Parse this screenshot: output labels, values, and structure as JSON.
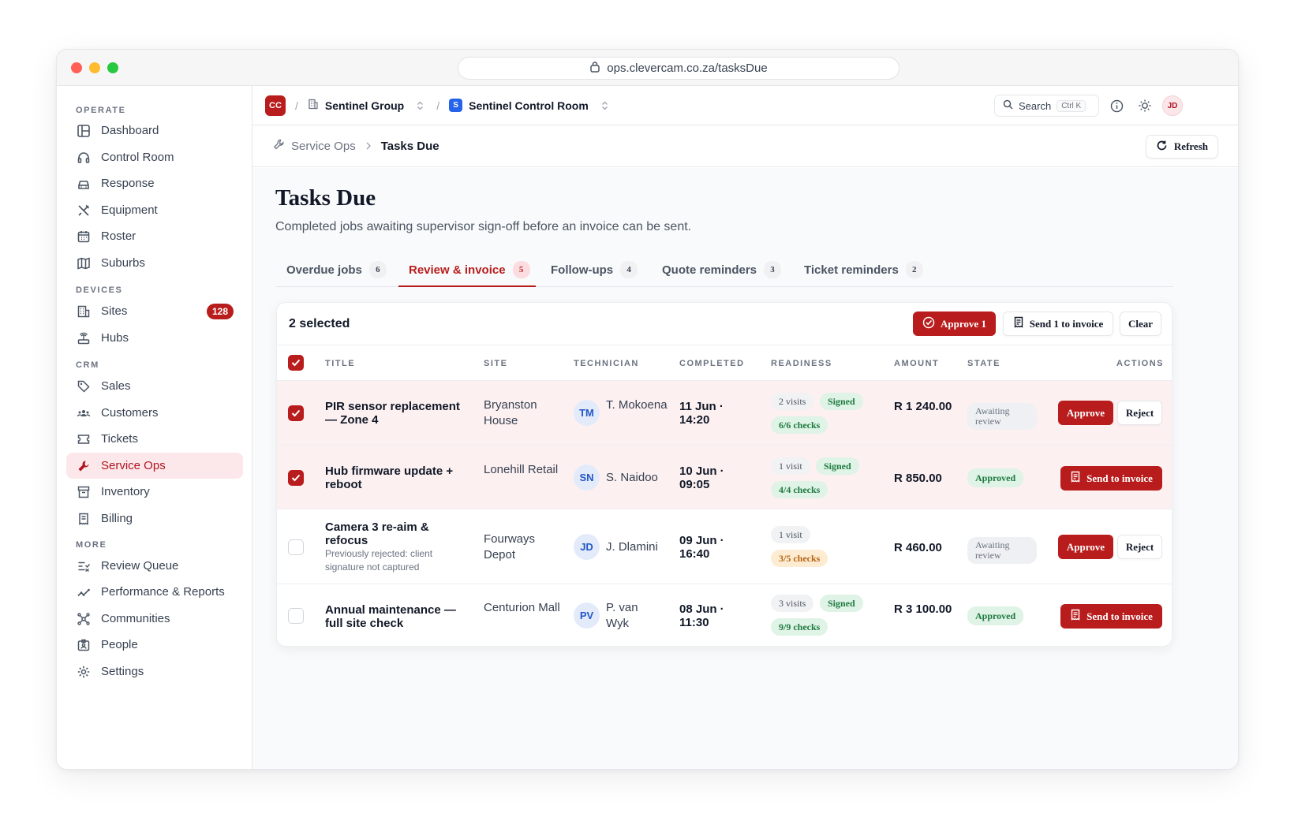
{
  "browser": {
    "url": "ops.clevercam.co.za/tasksDue"
  },
  "sidebar": {
    "sections": {
      "operate": "OPERATE",
      "devices": "DEVICES",
      "crm": "CRM",
      "more": "MORE"
    },
    "items": {
      "dashboard": "Dashboard",
      "control_room": "Control Room",
      "response": "Response",
      "equipment": "Equipment",
      "roster": "Roster",
      "suburbs": "Suburbs",
      "sites": "Sites",
      "sites_badge": "128",
      "hubs": "Hubs",
      "sales": "Sales",
      "customers": "Customers",
      "tickets": "Tickets",
      "service_ops": "Service Ops",
      "inventory": "Inventory",
      "billing": "Billing",
      "review_queue": "Review Queue",
      "performance": "Performance & Reports",
      "communities": "Communities",
      "people": "People",
      "settings": "Settings"
    }
  },
  "topbar": {
    "logo": "CC",
    "org": "Sentinel Group",
    "workspace_icon": "S",
    "workspace": "Sentinel Control Room",
    "search_label": "Search",
    "search_shortcut": "Ctrl K",
    "user_initials": "JD"
  },
  "breadcrumb": {
    "parent": "Service Ops",
    "current": "Tasks Due",
    "refresh_label": "Refresh"
  },
  "page": {
    "title": "Tasks Due",
    "subtitle": "Completed jobs awaiting supervisor sign-off before an invoice can be sent."
  },
  "tabs": [
    {
      "label": "Overdue jobs",
      "count": "6"
    },
    {
      "label": "Review & invoice",
      "count": "5",
      "active": true
    },
    {
      "label": "Follow-ups",
      "count": "4"
    },
    {
      "label": "Quote reminders",
      "count": "3"
    },
    {
      "label": "Ticket reminders",
      "count": "2"
    }
  ],
  "selection": {
    "label": "2 selected",
    "approve_label": "Approve 1",
    "send_label": "Send 1 to invoice",
    "clear_label": "Clear"
  },
  "table": {
    "headers": {
      "title": "TITLE",
      "site": "SITE",
      "technician": "TECHNICIAN",
      "completed": "COMPLETED",
      "readiness": "READINESS",
      "amount": "AMOUNT",
      "state": "STATE",
      "actions": "ACTIONS"
    },
    "rows": [
      {
        "selected": true,
        "title": "PIR sensor replacement — Zone 4",
        "note": "",
        "site": "Bryanston House",
        "tech_initials": "TM",
        "tech": "T. Mokoena",
        "completed": "11 Jun · 14:20",
        "visits": "2 visits",
        "signed": "Signed",
        "checks": "6/6 checks",
        "amount": "R 1 240.00",
        "state": "Awaiting review",
        "action_primary": "Approve",
        "action_secondary": "Reject"
      },
      {
        "selected": true,
        "title": "Hub firmware update + reboot",
        "note": "",
        "site": "Lonehill Retail",
        "tech_initials": "SN",
        "tech": "S. Naidoo",
        "completed": "10 Jun · 09:05",
        "visits": "1 visit",
        "signed": "Signed",
        "checks": "4/4 checks",
        "amount": "R 850.00",
        "state": "Approved",
        "action_primary": "Send to invoice"
      },
      {
        "selected": false,
        "title": "Camera 3 re-aim & refocus",
        "note": "Previously rejected: client signature not captured",
        "site": "Fourways Depot",
        "tech_initials": "JD",
        "tech": "J. Dlamini",
        "completed": "09 Jun · 16:40",
        "visits": "1 visit",
        "checks": "3/5 checks",
        "amount": "R 460.00",
        "state": "Awaiting review",
        "action_primary": "Approve",
        "action_secondary": "Reject"
      },
      {
        "selected": false,
        "title": "Annual maintenance — full site check",
        "note": "",
        "site": "Centurion Mall",
        "tech_initials": "PV",
        "tech": "P. van Wyk",
        "completed": "08 Jun · 11:30",
        "visits": "3 visits",
        "signed": "Signed",
        "checks": "9/9 checks",
        "amount": "R 3 100.00",
        "state": "Approved",
        "action_primary": "Send to invoice"
      }
    ]
  },
  "colors": {
    "accent": "#b91c1c",
    "success": "#1e7a40",
    "warning": "#b76414"
  }
}
